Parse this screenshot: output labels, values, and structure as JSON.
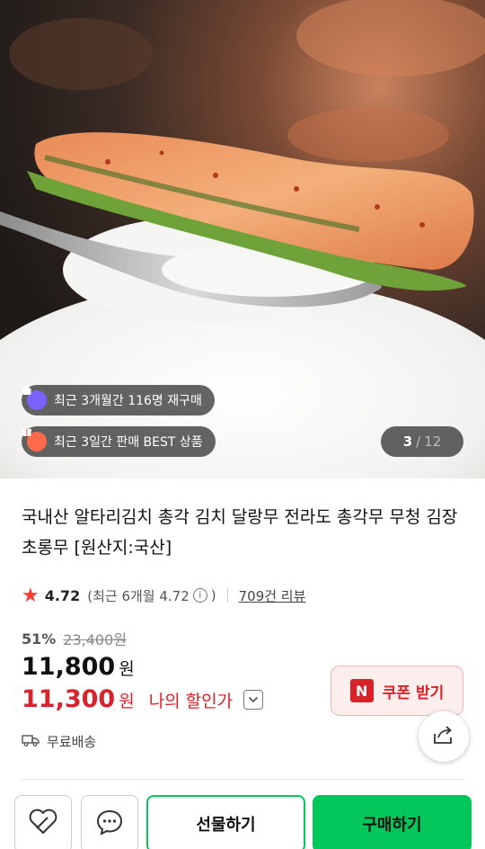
{
  "hero": {
    "badges": [
      {
        "icon": "bag-icon",
        "text": "최근 3개월간 116명 재구매"
      },
      {
        "icon": "gift-icon",
        "text": "최근 3일간 판매 BEST 상품"
      }
    ],
    "counter": {
      "current": "3",
      "separator": "/",
      "total": "12"
    }
  },
  "product": {
    "title": "국내산 알타리김치 총각 김치 달랑무 전라도 총각무 무청 김장 초롱무 [원산지:국산]",
    "rating": {
      "score": "4.72",
      "recent_prefix": "(최근 6개월 4.72",
      "recent_suffix": ")",
      "review_count": "709건 리뷰"
    },
    "discount_rate": "51%",
    "original_price": "23,400원",
    "price": "11,800",
    "price_unit": "원",
    "my_price": "11,300",
    "my_price_unit": "원",
    "my_price_label": "나의 할인가",
    "coupon": {
      "badge": "N",
      "label": "쿠폰 받기"
    },
    "shipping": "무료배송"
  },
  "bottom_bar": {
    "gift_label": "선물하기",
    "buy_label": "구매하기"
  },
  "colors": {
    "accent_red": "#d8232a",
    "naver_green": "#03c75a",
    "star": "#ff3b2f"
  }
}
